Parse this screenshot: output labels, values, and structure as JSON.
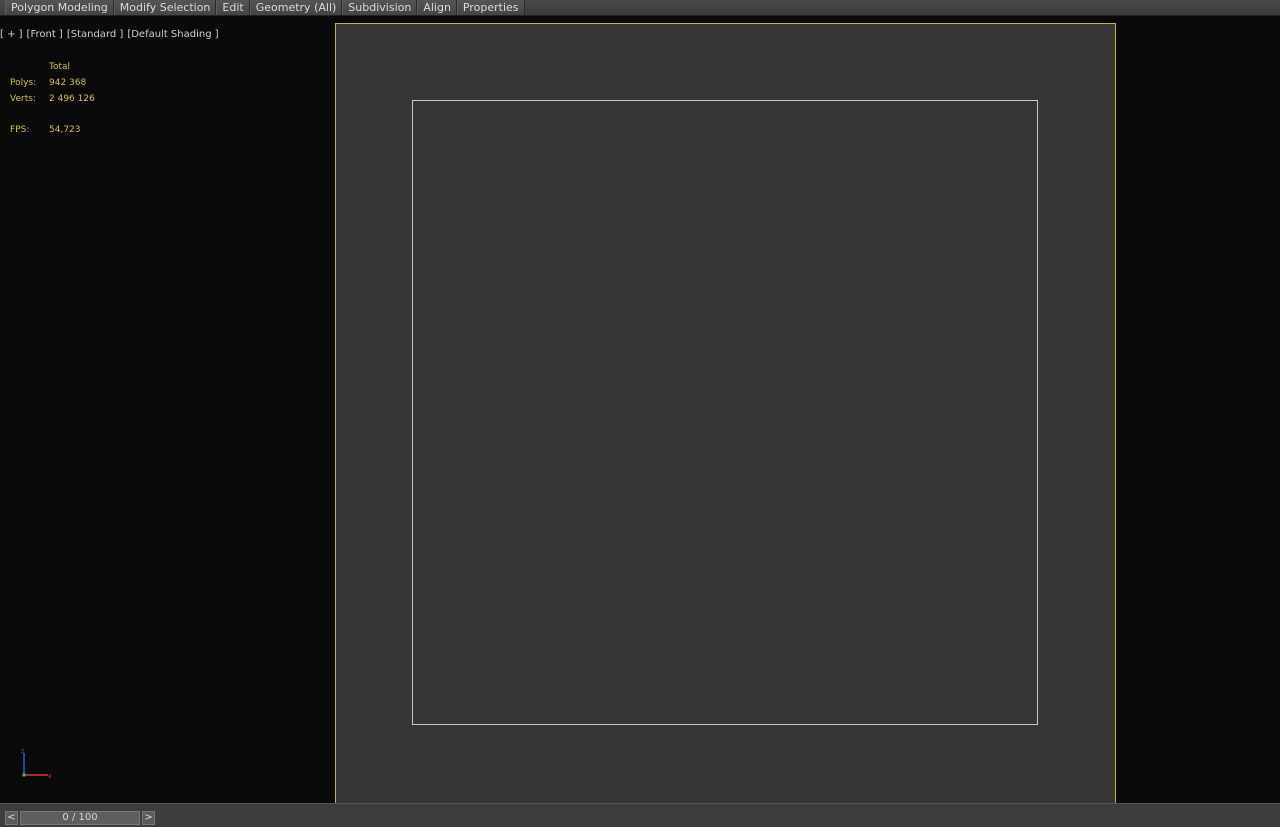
{
  "ribbon": {
    "tabs": [
      {
        "label": "Polygon Modeling"
      },
      {
        "label": "Modify Selection"
      },
      {
        "label": "Edit"
      },
      {
        "label": "Geometry (All)"
      },
      {
        "label": "Subdivision"
      },
      {
        "label": "Align"
      },
      {
        "label": "Properties"
      }
    ]
  },
  "viewport": {
    "labels": [
      "[ + ]",
      "[Front ]",
      "[Standard ]",
      "[Default Shading ]"
    ],
    "stats": {
      "header": "Total",
      "polys_label": "Polys:",
      "polys_value": "942 368",
      "verts_label": "Verts:",
      "verts_value": "2 496 126",
      "fps_label": "FPS:",
      "fps_value": "54,723"
    },
    "gizmo_icon": "axis-tripod-icon",
    "colors": {
      "safe_frame_border": "#c8b62a",
      "stats_text": "#d4c145",
      "frame_fill": "#363636"
    }
  },
  "timeline": {
    "prev_label": "<",
    "next_label": ">",
    "frame_display": "0 / 100",
    "current_frame": 0,
    "total_frames": 100
  }
}
